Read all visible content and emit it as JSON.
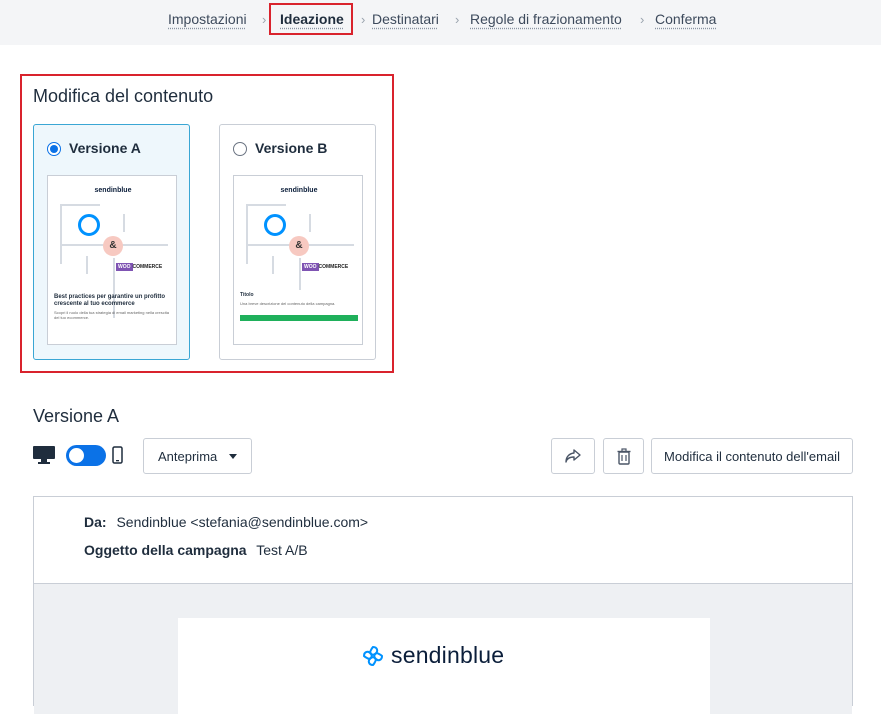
{
  "stepper": {
    "steps": [
      "Impostazioni",
      "Ideazione",
      "Destinatari",
      "Regole di frazionamento",
      "Conferma"
    ],
    "active_index": 1
  },
  "content_section": {
    "title": "Modifica del contenuto",
    "versions": [
      {
        "label": "Versione A",
        "selected": true,
        "thumbnail": {
          "logo": "sendinblue",
          "headline": "Best practices per garantire un profitto crescente al tuo ecommerce",
          "body": "Scopri il ruolo della tua strategia di email marketing nella crescita del tuo ecommerce.",
          "partner": "WOO COMMERCE"
        }
      },
      {
        "label": "Versione B",
        "selected": false,
        "thumbnail": {
          "logo": "sendinblue",
          "headline": "Titolo",
          "body": "Una breve descrizione del contenuto della campagna.",
          "partner": "WOO COMMERCE"
        }
      }
    ]
  },
  "preview": {
    "title": "Versione A",
    "device_toggle": "desktop",
    "preview_label": "Anteprima",
    "edit_label": "Modifica il contenuto dell'email",
    "from_label": "Da:",
    "from_value": "Sendinblue <stefania@sendinblue.com>",
    "subject_label": "Oggetto della campagna",
    "subject_value": "Test A/B",
    "brand": "sendinblue"
  },
  "colors": {
    "accent": "#0b72e7",
    "highlight": "#d9232d",
    "brand_blue": "#0092ff"
  }
}
